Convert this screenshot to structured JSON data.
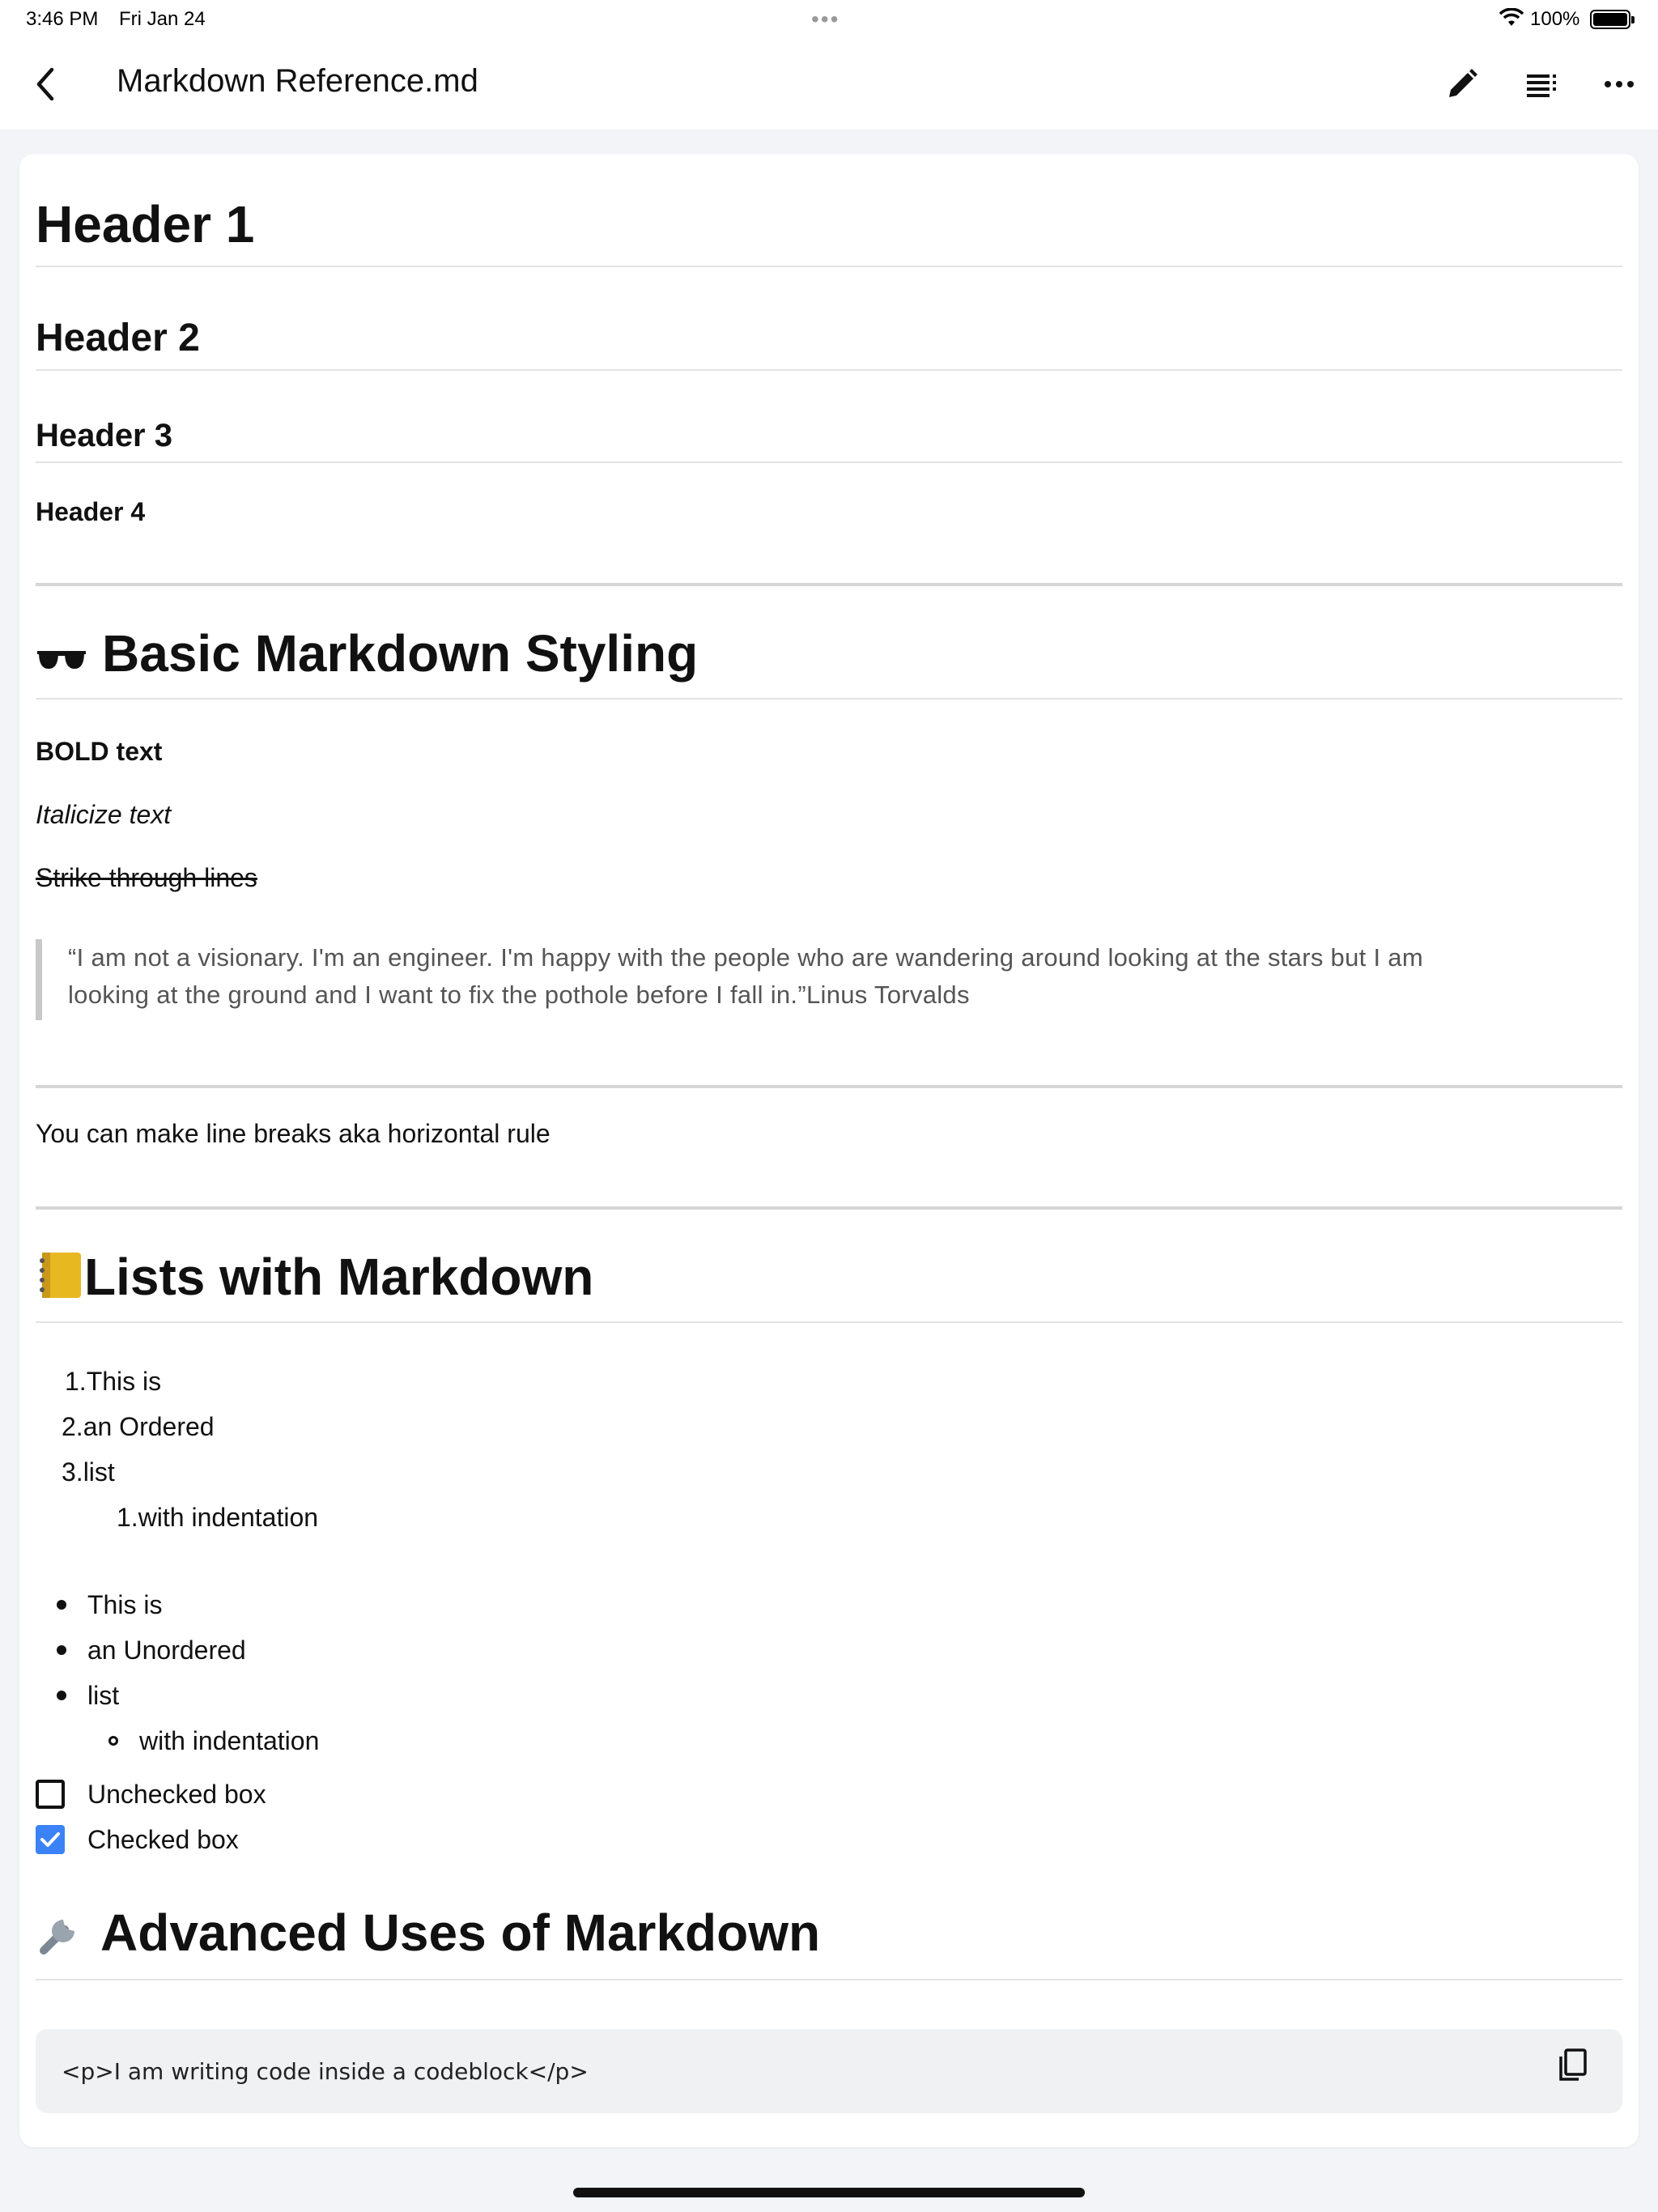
{
  "status_bar": {
    "time": "3:46 PM",
    "date": "Fri Jan 24",
    "battery": "100%"
  },
  "nav": {
    "title": "Markdown Reference.md",
    "icons": [
      "back-chevron-icon",
      "pencil-icon",
      "outline-list-icon",
      "more-icon"
    ]
  },
  "doc": {
    "h1": "Header 1",
    "h2": "Header 2",
    "h3": "Header 3",
    "h4": "Header 4",
    "basic_heading": "Basic Markdown Styling",
    "bold_text": "BOLD text",
    "italic_text": "Italicize text",
    "strike_text": "Strike through lines",
    "quote_line1": "“I am not a visionary. I'm an engineer. I'm happy with the people who are wandering around looking at the stars but I am",
    "quote_line2": "looking at the ground and I want to fix the pothole before I fall in.”Linus Torvalds",
    "hr_text": "You can make line breaks aka horizontal rule",
    "lists_heading": "Lists with Markdown",
    "ordered": [
      {
        "num": "1.",
        "text": "This is"
      },
      {
        "num": "2.",
        "text": "an Ordered"
      },
      {
        "num": "3.",
        "text": "list"
      }
    ],
    "ordered_nested": {
      "num": "1.",
      "text": "with indentation"
    },
    "unordered": [
      "This is",
      "an Unordered",
      "list"
    ],
    "unordered_nested": "with indentation",
    "unchecked": "Unchecked box",
    "checked": "Checked box",
    "advanced_heading": "Advanced Uses of Markdown",
    "code": "<p>I am writing code inside a codeblock</p>"
  },
  "colors": {
    "checkbox_accent": "#3b82f6",
    "code_bg": "#f0f1f3",
    "page_bg": "#f2f4f8"
  }
}
